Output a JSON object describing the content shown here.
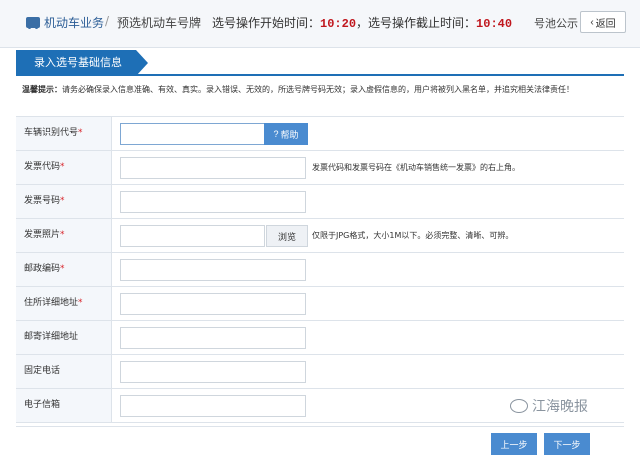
{
  "header": {
    "breadcrumb_1": "机动车业务",
    "breadcrumb_sep": "/",
    "breadcrumb_2": "预选机动车号牌",
    "start_label": "选号操作开始时间：",
    "start_time": "10:20",
    "end_label": "，选号操作截止时间：",
    "end_time": "10:40",
    "pool_link": "号池公示",
    "back_label": "返回",
    "back_icon": "chevron-left-icon"
  },
  "section": {
    "tab_title": "录入选号基础信息",
    "warning_lead": "温馨提示：",
    "warning_text": "请务必确保录入信息准确、有效、真实。录入错误、无效的，所选号牌号码无效；录入虚假信息的，用户将被列入黑名单，并追究相关法律责任！"
  },
  "form": {
    "vin": {
      "label": "车辆识别代号",
      "required_mark": "*",
      "value": "",
      "help_label": "帮助",
      "help_icon": "question-circle-icon"
    },
    "invoice_code": {
      "label": "发票代码",
      "required_mark": "*",
      "value": "",
      "hint": "发票代码和发票号码在《机动车销售统一发票》的右上角。"
    },
    "invoice_number": {
      "label": "发票号码",
      "required_mark": "*",
      "value": ""
    },
    "invoice_photo": {
      "label": "发票照片",
      "required_mark": "*",
      "value": "",
      "browse_label": "浏览",
      "hint": "仅限于JPG格式，大小1M以下。必须完整、清晰、可辨。"
    },
    "postcode": {
      "label": "邮政编码",
      "required_mark": "*",
      "value": ""
    },
    "address": {
      "label": "住所详细地址",
      "required_mark": "*",
      "value": ""
    },
    "mailing_address": {
      "label": "邮寄详细地址",
      "value": ""
    },
    "phone": {
      "label": "固定电话",
      "value": ""
    },
    "email": {
      "label": "电子信箱",
      "value": ""
    }
  },
  "footer": {
    "watermark": "江海晚报",
    "prev_label": "上一步",
    "next_label": "下一步"
  },
  "colors": {
    "accent": "#1e6fb6",
    "button": "#4a8bd0",
    "time": "#c0161d",
    "required": "#d8262c"
  }
}
